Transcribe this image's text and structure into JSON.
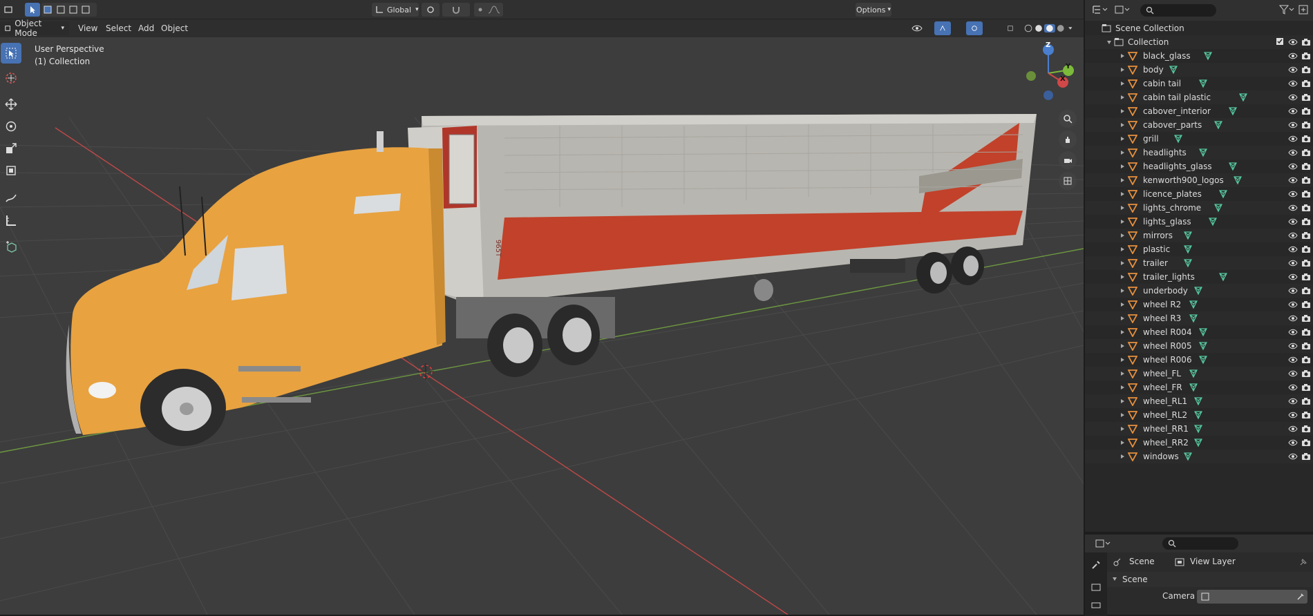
{
  "header": {
    "transform_orientation": "Global",
    "options_label": "Options"
  },
  "menubar": {
    "mode": "Object Mode",
    "menus": [
      "View",
      "Select",
      "Add",
      "Object"
    ]
  },
  "viewport": {
    "perspective_label": "User Perspective",
    "collection_label": "(1) Collection",
    "trailer_text": "965T",
    "gizmo_axes": [
      "Z",
      "Y",
      "X"
    ]
  },
  "outliner": {
    "scene_collection": "Scene Collection",
    "collection": "Collection",
    "objects": [
      "black_glass",
      "body",
      "cabin tail",
      "cabin tail plastic",
      "cabover_interior",
      "cabover_parts",
      "grill",
      "headlights",
      "headlights_glass",
      "kenworth900_logos",
      "licence_plates",
      "lights_chrome",
      "lights_glass",
      "mirrors",
      "plastic",
      "trailer",
      "trailer_lights",
      "underbody",
      "wheel R2",
      "wheel R3",
      "wheel R004",
      "wheel R005",
      "wheel R006",
      "wheel_FL",
      "wheel_FR",
      "wheel_RL1",
      "wheel_RL2",
      "wheel_RR1",
      "wheel_RR2",
      "windows"
    ]
  },
  "properties": {
    "scene_tab": "Scene",
    "view_layer_tab": "View Layer",
    "panel_title": "Scene",
    "camera_label": "Camera"
  },
  "colors": {
    "accent": "#4772b3",
    "object_icon": "#e8903c",
    "mesh_icon": "#55c9a0",
    "viewport_bg": "#3d3d3d"
  }
}
